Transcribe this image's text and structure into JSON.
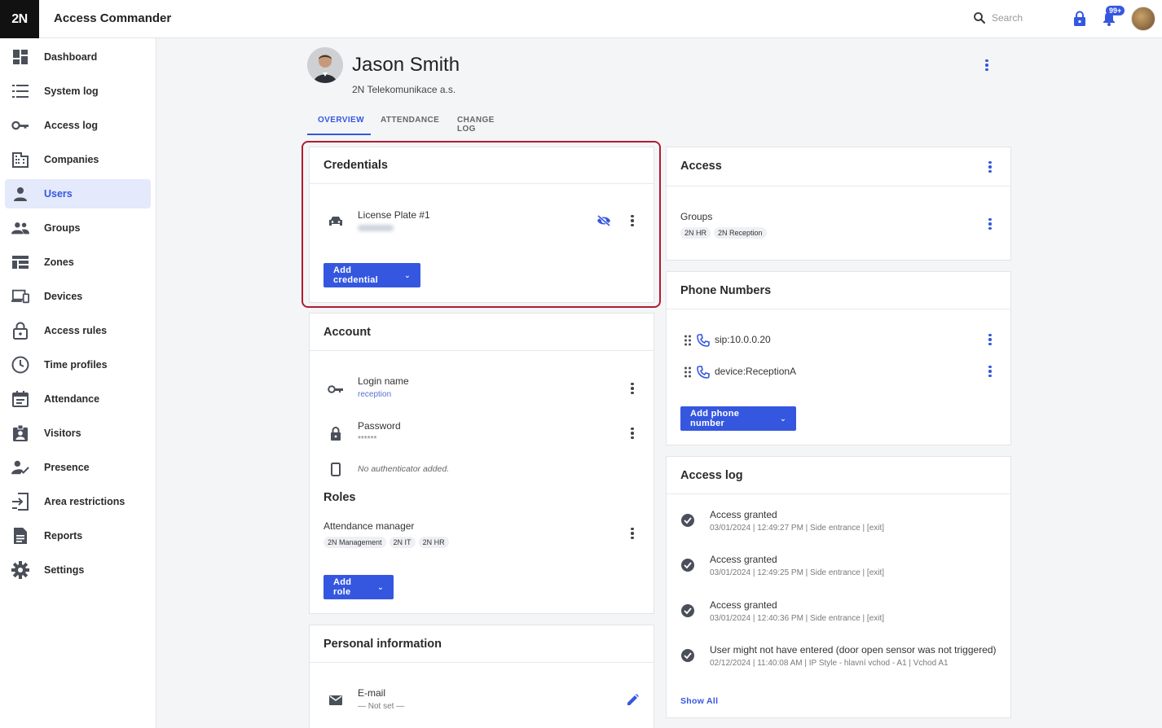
{
  "app": {
    "logo": "2N",
    "title": "Access Commander"
  },
  "topbar": {
    "search_placeholder": "Search",
    "notifications_badge": "99+"
  },
  "sidebar": {
    "items": [
      {
        "label": "Dashboard",
        "icon": "dashboard-icon"
      },
      {
        "label": "System log",
        "icon": "list-icon"
      },
      {
        "label": "Access log",
        "icon": "key-icon"
      },
      {
        "label": "Companies",
        "icon": "building-icon"
      },
      {
        "label": "Users",
        "icon": "user-icon"
      },
      {
        "label": "Groups",
        "icon": "groups-icon"
      },
      {
        "label": "Zones",
        "icon": "zones-icon"
      },
      {
        "label": "Devices",
        "icon": "devices-icon"
      },
      {
        "label": "Access rules",
        "icon": "lock-icon"
      },
      {
        "label": "Time profiles",
        "icon": "clock-icon"
      },
      {
        "label": "Attendance",
        "icon": "calendar-icon"
      },
      {
        "label": "Visitors",
        "icon": "visitor-badge-icon"
      },
      {
        "label": "Presence",
        "icon": "presence-icon"
      },
      {
        "label": "Area restrictions",
        "icon": "area-icon"
      },
      {
        "label": "Reports",
        "icon": "report-icon"
      },
      {
        "label": "Settings",
        "icon": "gear-icon"
      }
    ],
    "active": "Users"
  },
  "profile": {
    "name": "Jason Smith",
    "company": "2N Telekomunikace a.s."
  },
  "tabs": [
    {
      "label": "OVERVIEW"
    },
    {
      "label": "ATTENDANCE"
    },
    {
      "label": "CHANGE LOG"
    }
  ],
  "credentials": {
    "title": "Credentials",
    "item": {
      "title": "License Plate #1"
    },
    "add_button": "Add credential"
  },
  "account": {
    "title": "Account",
    "login": {
      "title": "Login name",
      "value": "reception"
    },
    "password": {
      "title": "Password",
      "value": "******"
    },
    "authenticator": "No authenticator added.",
    "roles_title": "Roles",
    "role": {
      "title": "Attendance manager",
      "chips": [
        "2N Management",
        "2N IT",
        "2N HR"
      ]
    },
    "add_role": "Add role"
  },
  "personal": {
    "title": "Personal information",
    "email": {
      "title": "E-mail",
      "value": "— Not set —"
    }
  },
  "access": {
    "title": "Access",
    "groups_label": "Groups",
    "groups": [
      "2N HR",
      "2N Reception"
    ]
  },
  "phones": {
    "title": "Phone Numbers",
    "items": [
      "sip:10.0.0.20",
      "device:ReceptionA"
    ],
    "add_button": "Add phone number"
  },
  "access_log": {
    "title": "Access log",
    "entries": [
      {
        "title": "Access granted",
        "detail": "03/01/2024 | 12:49:27 PM | Side entrance | [exit]"
      },
      {
        "title": "Access granted",
        "detail": "03/01/2024 | 12:49:25 PM | Side entrance | [exit]"
      },
      {
        "title": "Access granted",
        "detail": "03/01/2024 | 12:40:36 PM | Side entrance | [exit]"
      },
      {
        "title": "User might not have entered (door open sensor was not triggered)",
        "detail": "02/12/2024 | 11:40:08 AM | IP Style - hlavní vchod - A1 | Vchod A1"
      }
    ],
    "show_all": "Show All"
  }
}
